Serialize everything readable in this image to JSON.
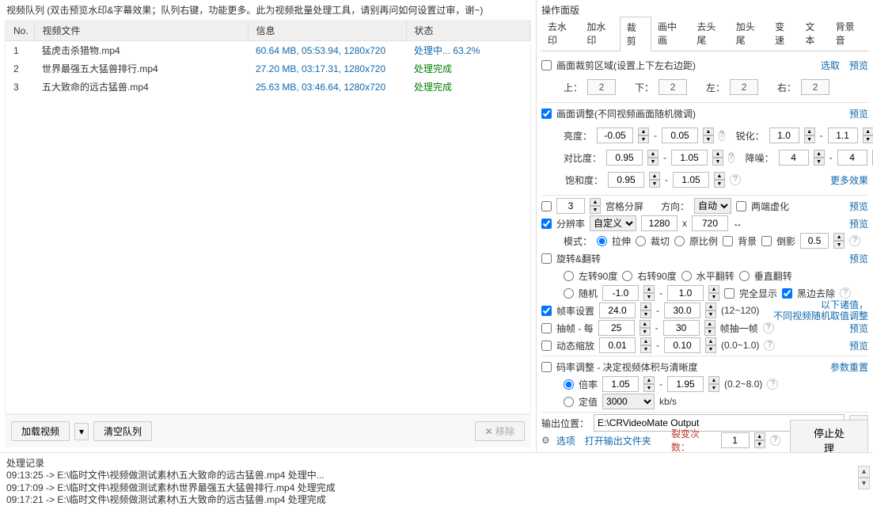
{
  "leftTitle": "视频队列 (双击预览水印&字幕效果；队列右键，功能更多。此为视频批量处理工具，请别再问如何设置过审，谢~)",
  "cols": {
    "no": "No.",
    "file": "视频文件",
    "info": "信息",
    "status": "状态"
  },
  "rows": [
    {
      "no": "1",
      "file": "猛虎击杀猎物.mp4",
      "info": "60.64 MB, 05:53.94, 1280x720",
      "status": "处理中... 63.2%",
      "statusClass": "blue"
    },
    {
      "no": "2",
      "file": "世界最强五大猛兽排行.mp4",
      "info": "27.20 MB, 03:17.31, 1280x720",
      "status": "处理完成",
      "statusClass": "green"
    },
    {
      "no": "3",
      "file": "五大致命的远古猛兽.mp4",
      "info": "25.63 MB, 03:46.64, 1280x720",
      "status": "处理完成",
      "statusClass": "green"
    }
  ],
  "leftButtons": {
    "load": "加载视频",
    "clear": "清空队列",
    "remove": "移除"
  },
  "logTitle": "处理记录",
  "logs": [
    "09:13:25 -> E:\\临时文件\\视频做测试素材\\五大致命的远古猛兽.mp4 处理中...",
    "09:17:09 -> E:\\临时文件\\视频做测试素材\\世界最强五大猛兽排行.mp4 处理完成",
    "09:17:21 -> E:\\临时文件\\视频做测试素材\\五大致命的远古猛兽.mp4 处理完成"
  ],
  "rp": {
    "title": "操作面版",
    "tabs": [
      "去水印",
      "加水印",
      "裁剪",
      "画中画",
      "去头尾",
      "加头尾",
      "变速",
      "文本",
      "背景音"
    ],
    "activeTab": 2,
    "cropLabel": "画面裁剪区域(设置上下左右边距)",
    "select": "选取",
    "preview": "预览",
    "top": "上：",
    "bottom": "下：",
    "left": "左：",
    "right": "右：",
    "cropVals": {
      "top": "2",
      "bottom": "2",
      "left": "2",
      "right": "2"
    },
    "adjustLabel": "画面调整(不同视频画面随机微调)",
    "brightness": "亮度：",
    "contrast": "对比度：",
    "saturation": "饱和度：",
    "sharpen": "锐化：",
    "denoise": "降噪：",
    "vals": {
      "b1": "-0.05",
      "b2": "0.05",
      "c1": "0.95",
      "c2": "1.05",
      "s1": "0.95",
      "s2": "1.05",
      "sh1": "1.0",
      "sh2": "1.1",
      "dn1": "4",
      "dn2": "4"
    },
    "moreFx": "更多效果",
    "gridLabel": "宫格分屏",
    "gridN": "3",
    "direction": "方向：",
    "auto": "自动",
    "twoEnd": "两端虚化",
    "resLabel": "分辨率",
    "resMode": "自定义",
    "resW": "1280",
    "resH": "720",
    "swap": "↔",
    "modeLabel": "模式：",
    "stretch": "拉伸",
    "crop": "裁切",
    "origRatio": "原比例",
    "bg": "背景",
    "mirror": "倒影",
    "mirrorVal": "0.5",
    "rotateLabel": "旋转&翻转",
    "rotL": "左转90度",
    "rotR": "右转90度",
    "flipH": "水平翻转",
    "flipV": "垂直翻转",
    "random": "随机",
    "rand1": "-1.0",
    "rand2": "1.0",
    "fullShow": "完全显示",
    "blackRemove": "黑边去除",
    "noteMulti1": "以下诸值，",
    "noteMulti2": "不同视频随机取值调整",
    "fpsLabel": "帧率设置",
    "fps1": "24.0",
    "fps2": "30.0",
    "fpsRange": "(12~120)",
    "extractLabel": "抽帧 - 每",
    "ext1": "25",
    "ext2": "30",
    "extractUnit": "帧抽一帧",
    "dynamicLabel": "动态缩放",
    "dyn1": "0.01",
    "dyn2": "0.10",
    "dynRange": "(0.0~1.0)",
    "bitrateLabel": "码率调整 - 决定视频体积与清晰度",
    "resetParams": "参数重置",
    "multiplier": "倍率",
    "mul1": "1.05",
    "mul2": "1.95",
    "mulRange": "(0.2~8.0)",
    "fixed": "定值",
    "fixedVal": "3000",
    "kbps": "kb/s",
    "outLabel": "输出位置：",
    "outPath": "E:\\CRVideoMate Output",
    "options": "选项",
    "openOut": "打开输出文件夹",
    "fissionLabel": "裂变次数：",
    "fissionVal": "1",
    "stop": "停止处理"
  }
}
